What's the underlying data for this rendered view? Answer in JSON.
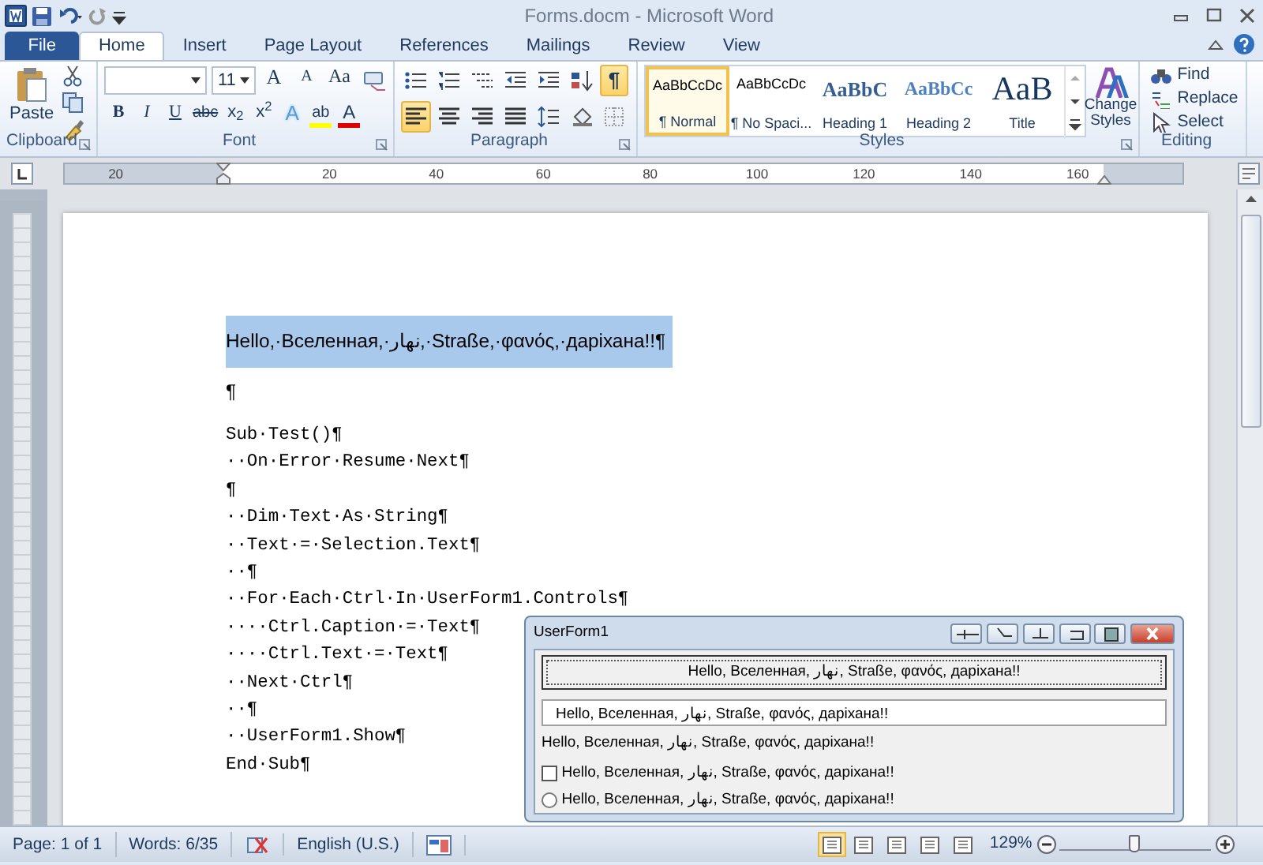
{
  "window": {
    "title": "Forms.docm - Microsoft Word"
  },
  "tabs": [
    {
      "label": "File",
      "kind": "file",
      "selected": false
    },
    {
      "label": "Home",
      "kind": "tab",
      "selected": true
    },
    {
      "label": "Insert",
      "kind": "tab",
      "selected": false
    },
    {
      "label": "Page Layout",
      "kind": "tab",
      "selected": false
    },
    {
      "label": "References",
      "kind": "tab",
      "selected": false
    },
    {
      "label": "Mailings",
      "kind": "tab",
      "selected": false
    },
    {
      "label": "Review",
      "kind": "tab",
      "selected": false
    },
    {
      "label": "View",
      "kind": "tab",
      "selected": false
    }
  ],
  "clipboard": {
    "paste": "Paste",
    "label": "Clipboard"
  },
  "font": {
    "size": "11",
    "label": "Font",
    "row_1": [
      {
        "kind": "grow",
        "text": "A"
      },
      {
        "kind": "shrink",
        "text": "A"
      },
      {
        "kind": "case",
        "text": "Aa"
      },
      {
        "kind": "clear"
      }
    ],
    "row_2": [
      {
        "kind": "bold",
        "text": "B"
      },
      {
        "kind": "italic",
        "text": "I"
      },
      {
        "kind": "underline",
        "text": "U"
      },
      {
        "kind": "strike",
        "text": "abc"
      },
      {
        "kind": "sub",
        "text": "x$_{2}$"
      },
      {
        "kind": "sup",
        "text": "x$^{2}$"
      },
      {
        "kind": "effects",
        "text": "A"
      },
      {
        "kind": "highlight",
        "text": "ab",
        "color": "#ffff00"
      },
      {
        "kind": "color",
        "text": "A",
        "color": "#e00000"
      }
    ]
  },
  "paragraph": {
    "label": "Paragraph",
    "row_1": [
      {
        "kind": "bullets",
        "selected": false
      },
      {
        "kind": "numbering",
        "selected": false
      },
      {
        "kind": "multilevel",
        "selected": false
      },
      {
        "kind": "outdent",
        "selected": false
      },
      {
        "kind": "indent",
        "selected": false
      },
      {
        "kind": "sort",
        "selected": false
      },
      {
        "kind": "marks",
        "text": "¶",
        "selected": true
      }
    ],
    "row_2": [
      {
        "kind": "left",
        "selected": true
      },
      {
        "kind": "center",
        "selected": false
      },
      {
        "kind": "right",
        "selected": false
      },
      {
        "kind": "justify",
        "selected": false
      },
      {
        "kind": "spacing",
        "selected": false
      },
      {
        "kind": "shading",
        "selected": false
      },
      {
        "kind": "borders",
        "selected": false
      }
    ]
  },
  "styles": {
    "label": "Styles",
    "change": "Change Styles",
    "items": [
      {
        "preview": "AaBbCcDc",
        "name": "¶ Normal",
        "kind": "normal",
        "selected": true
      },
      {
        "preview": "AaBbCcDc",
        "name": "¶ No Spaci...",
        "kind": "normal",
        "selected": false
      },
      {
        "preview": "AaBbC",
        "name": "Heading 1",
        "kind": "heading1",
        "selected": false
      },
      {
        "preview": "AaBbCc",
        "name": "Heading 2",
        "kind": "heading2",
        "selected": false
      },
      {
        "preview": "AaB",
        "name": "Title",
        "kind": "title",
        "selected": false
      }
    ]
  },
  "editing": {
    "label": "Editing",
    "items": [
      {
        "kind": "find",
        "text": "Find"
      },
      {
        "kind": "replace",
        "text": "Replace"
      },
      {
        "kind": "select",
        "text": "Select"
      }
    ]
  },
  "ruler": {
    "ticks": [
      "20",
      "20",
      "40",
      "60",
      "80",
      "100",
      "120",
      "140",
      "160"
    ]
  },
  "document": {
    "lines": [
      {
        "text": "Hello,·Вселенная,·نهار,·Straße,·φανός,·дарiхана!!¶",
        "kind": "prose",
        "selected": true
      },
      {
        "text": "¶",
        "kind": "prose",
        "selected": false
      },
      {
        "text": "Sub·Test()¶",
        "kind": "code",
        "selected": false
      },
      {
        "text": "··On·Error·Resume·Next¶",
        "kind": "code",
        "selected": false
      },
      {
        "text": "¶",
        "kind": "code",
        "selected": false
      },
      {
        "text": "··Dim·Text·As·String¶",
        "kind": "code",
        "selected": false
      },
      {
        "text": "··Text·=·Selection.Text¶",
        "kind": "code",
        "selected": false
      },
      {
        "text": "··¶",
        "kind": "code",
        "selected": false
      },
      {
        "text": "··For·Each·Ctrl·In·UserForm1.Controls¶",
        "kind": "code",
        "selected": false
      },
      {
        "text": "····Ctrl.Caption·=·Text¶",
        "kind": "code",
        "selected": false
      },
      {
        "text": "····Ctrl.Text·=·Text¶",
        "kind": "code",
        "selected": false
      },
      {
        "text": "··Next·Ctrl¶",
        "kind": "code",
        "selected": false
      },
      {
        "text": "··¶",
        "kind": "code",
        "selected": false
      },
      {
        "text": "··UserForm1.Show¶",
        "kind": "code",
        "selected": false
      },
      {
        "text": "End·Sub¶",
        "kind": "code",
        "selected": false
      }
    ]
  },
  "userform": {
    "title": "UserForm1",
    "button": "Hello, Вселенная, نهار, Straße, φανός, дарiхана!!",
    "textbox": "Hello, Вселенная, نهار, Straße, φανός, дарiхана!!",
    "label": "Hello, Вселенная, نهار, Straße, φανός, дарiхана!!",
    "checkbox": {
      "label": "Hello, Вселенная, نهار, Straße, φανός, дарiхана!!",
      "checked": false
    },
    "radio": {
      "label": "Hello, Вселенная, نهار, Straße, φανός, дарiхана!!",
      "selected": false
    }
  },
  "status_bar": {
    "page": "Page: 1 of 1",
    "words": "Words: 6/35",
    "language": "English (U.S.)",
    "zoom": "129%",
    "zoom_slider": {
      "level": 0.5
    },
    "views": [
      {
        "selected": true
      },
      {
        "selected": false
      },
      {
        "selected": false
      },
      {
        "selected": false
      },
      {
        "selected": false
      }
    ]
  }
}
